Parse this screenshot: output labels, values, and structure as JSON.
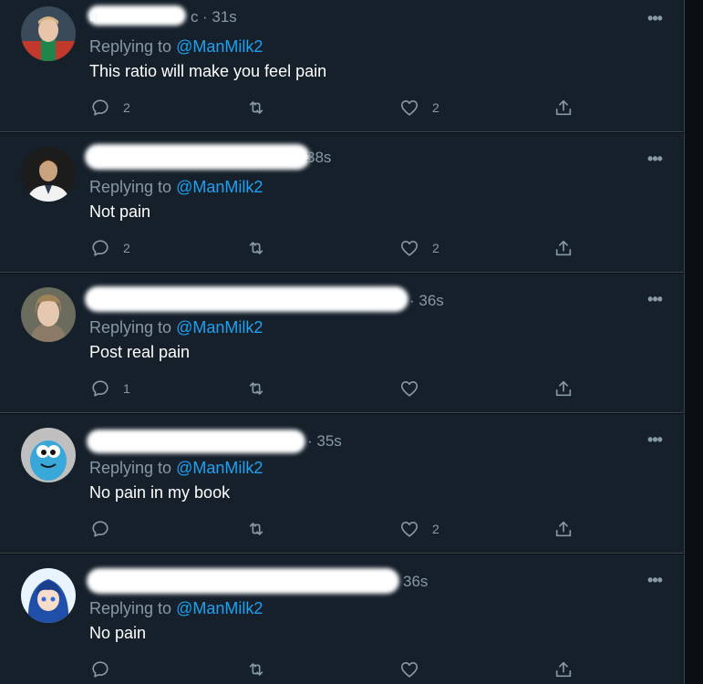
{
  "tweets": [
    {
      "handle_fragment": "n",
      "handle_tail": "c",
      "time": "· 31s",
      "replying_prefix": "Replying to ",
      "mention": "@ManMilk2",
      "text": "This ratio will make you feel pain",
      "reply_count": "2",
      "retweet_count": "",
      "like_count": "2"
    },
    {
      "handle_fragment": "",
      "handle_tail": "",
      "time": "38s",
      "replying_prefix": "Replying to ",
      "mention": "@ManMilk2",
      "text": "Not pain",
      "reply_count": "2",
      "retweet_count": "",
      "like_count": "2"
    },
    {
      "handle_fragment": "",
      "handle_tail": "",
      "time": "· 36s",
      "replying_prefix": "Replying to ",
      "mention": "@ManMilk2",
      "text": "Post real pain",
      "reply_count": "1",
      "retweet_count": "",
      "like_count": ""
    },
    {
      "handle_fragment": "",
      "handle_tail": "",
      "time": "· 35s",
      "replying_prefix": "Replying to ",
      "mention": "@ManMilk2",
      "text": "No pain in my book",
      "reply_count": "",
      "retweet_count": "",
      "like_count": "2"
    },
    {
      "handle_fragment": "",
      "handle_tail": "",
      "time": "36s",
      "replying_prefix": "Replying to ",
      "mention": "@ManMilk2",
      "text": "No pain",
      "reply_count": "",
      "retweet_count": "",
      "like_count": ""
    }
  ],
  "more_glyph": "•••",
  "icons": {
    "reply": "reply-icon",
    "retweet": "retweet-icon",
    "like": "heart-icon",
    "share": "share-icon",
    "more": "more-icon"
  },
  "colors": {
    "background": "#15202b",
    "border": "#38444d",
    "secondary_text": "#8899a6",
    "mention": "#1da1f2",
    "primary_text": "#ffffff"
  }
}
